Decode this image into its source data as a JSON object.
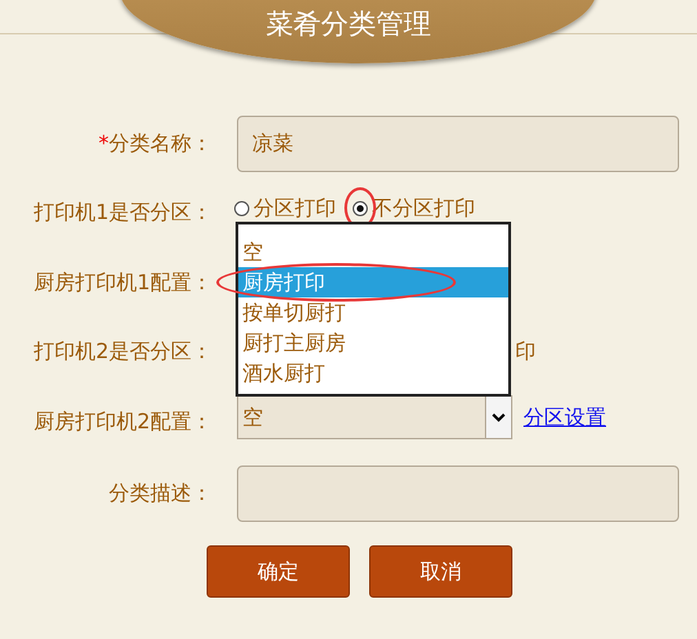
{
  "header": {
    "title": "菜肴分类管理"
  },
  "form": {
    "rows": [
      {
        "kind": "text",
        "label": "分类名称：",
        "required_mark": "*",
        "value": "凉菜"
      },
      {
        "kind": "radio",
        "label": "打印机1是否分区：",
        "options": [
          {
            "label": "分区打印",
            "selected": false,
            "circled": false
          },
          {
            "label": "不分区打印",
            "selected": true,
            "circled": true
          }
        ]
      },
      {
        "kind": "open_select",
        "label": "厨房打印机1配置：",
        "options": [
          {
            "label": "空",
            "selected": false,
            "circled": false
          },
          {
            "label": "厨房打印",
            "selected": true,
            "circled": true
          },
          {
            "label": "按单切厨打",
            "selected": false,
            "circled": false
          },
          {
            "label": "厨打主厨房",
            "selected": false,
            "circled": false
          },
          {
            "label": "酒水厨打",
            "selected": false,
            "circled": false
          }
        ]
      },
      {
        "kind": "covered",
        "label": "打印机2是否分区：",
        "visible_fragment": "印"
      },
      {
        "kind": "select",
        "label": "厨房打印机2配置：",
        "value": "空",
        "link": "分区设置"
      },
      {
        "kind": "textarea",
        "label": "分类描述："
      }
    ]
  },
  "buttons": [
    {
      "label": "确定"
    },
    {
      "label": "取消"
    }
  ]
}
